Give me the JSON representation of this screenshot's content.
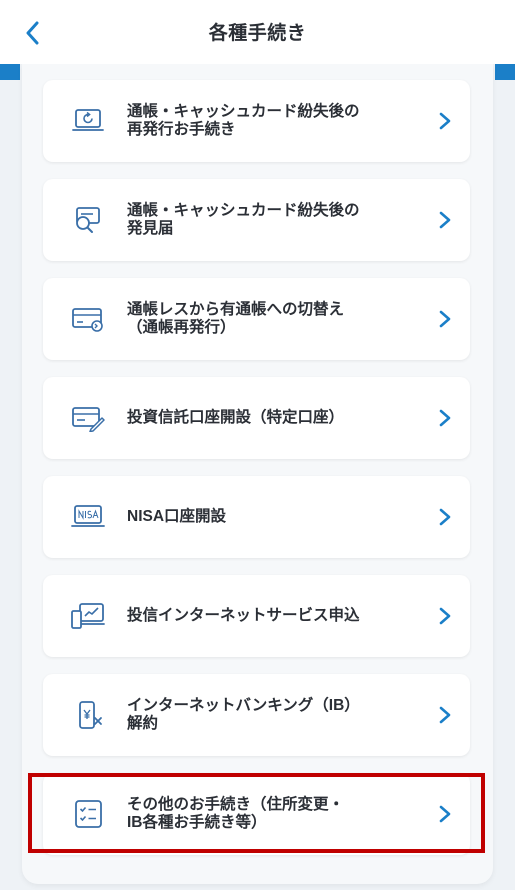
{
  "header": {
    "title": "各種手続き",
    "back_icon": "chevron-left-icon"
  },
  "colors": {
    "accent": "#1b7fc8",
    "icon": "#3a6fa8",
    "highlight": "#c00000"
  },
  "items": [
    {
      "label": "通帳・キャッシュカード紛失後の\n再発行お手続き",
      "icon": "laptop-refresh-icon"
    },
    {
      "label": "通帳・キャッシュカード紛失後の\n発見届",
      "icon": "card-search-icon"
    },
    {
      "label": "通帳レスから有通帳への切替え\n（通帳再発行）",
      "icon": "card-switch-icon"
    },
    {
      "label": "投資信託口座開設（特定口座）",
      "icon": "card-pen-icon"
    },
    {
      "label": "NISA口座開設",
      "icon": "nisa-laptop-icon"
    },
    {
      "label": "投信インターネットサービス申込",
      "icon": "devices-chart-icon"
    },
    {
      "label": "インターネットバンキング（IB）\n解約",
      "icon": "phone-cancel-icon"
    },
    {
      "label": "その他のお手続き（住所変更・\nIB各種お手続き等）",
      "icon": "checklist-icon"
    }
  ]
}
